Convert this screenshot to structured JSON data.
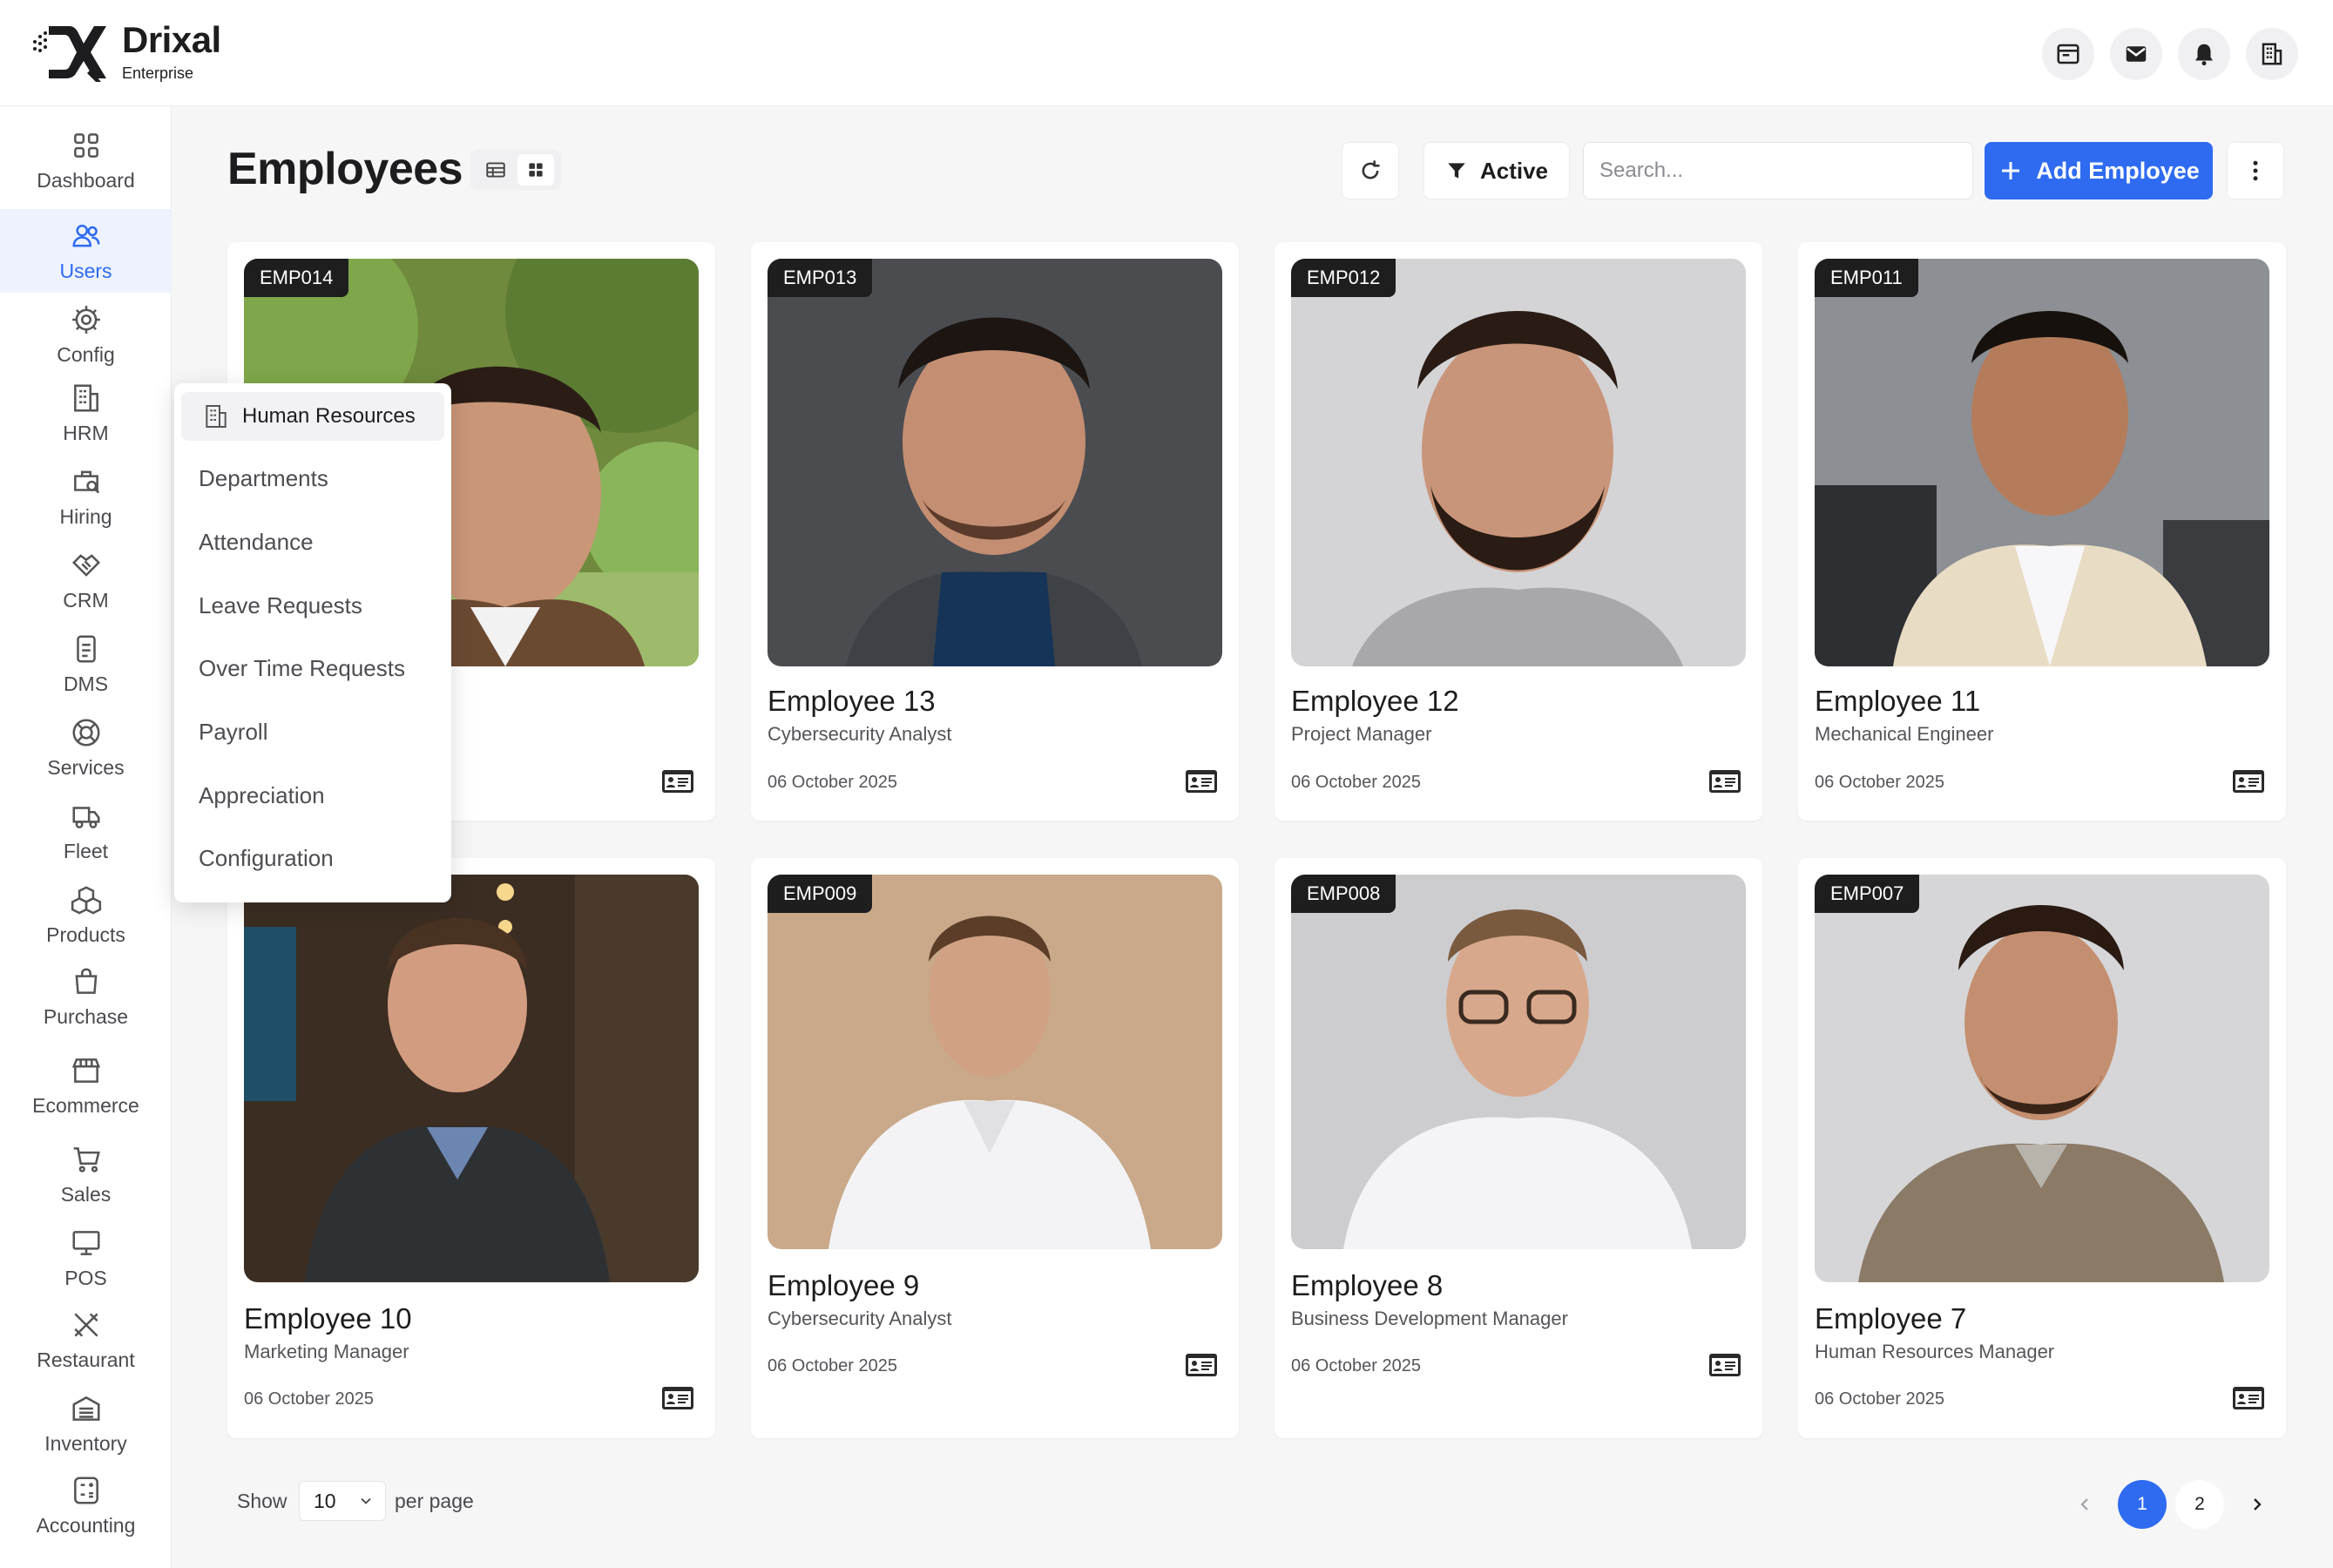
{
  "brand": {
    "name": "Drixal",
    "tagline": "Enterprise"
  },
  "topbar": {
    "icons": [
      "browser-window-icon",
      "mail-icon",
      "bell-icon",
      "building-icon"
    ]
  },
  "sidebar": {
    "items": [
      {
        "label": "Dashboard",
        "icon": "grid-icon"
      },
      {
        "label": "Users",
        "icon": "users-icon",
        "active": true
      },
      {
        "label": "Config",
        "icon": "gear-icon"
      },
      {
        "label": "HRM",
        "icon": "building-icon"
      },
      {
        "label": "Hiring",
        "icon": "briefcase-search-icon"
      },
      {
        "label": "CRM",
        "icon": "handshake-icon"
      },
      {
        "label": "DMS",
        "icon": "document-icon"
      },
      {
        "label": "Services",
        "icon": "lifebuoy-icon"
      },
      {
        "label": "Fleet",
        "icon": "truck-icon"
      },
      {
        "label": "Products",
        "icon": "boxes-icon"
      },
      {
        "label": "Purchase",
        "icon": "shopping-bag-icon"
      },
      {
        "label": "Ecommerce",
        "icon": "store-icon"
      },
      {
        "label": "Sales",
        "icon": "cart-icon"
      },
      {
        "label": "POS",
        "icon": "monitor-icon"
      },
      {
        "label": "Restaurant",
        "icon": "utensils-icon"
      },
      {
        "label": "Inventory",
        "icon": "warehouse-icon"
      },
      {
        "label": "Accounting",
        "icon": "calculator-icon"
      }
    ]
  },
  "hr_menu": {
    "title": "Human Resources",
    "items": [
      "Departments",
      "Attendance",
      "Leave Requests",
      "Over Time Requests",
      "Payroll",
      "Appreciation",
      "Configuration"
    ]
  },
  "page": {
    "title": "Employees",
    "filter_label": "Active",
    "search_placeholder": "Search...",
    "add_label": "Add Employee"
  },
  "employees": [
    {
      "code": "EMP014",
      "name": "",
      "role": "",
      "date": ""
    },
    {
      "code": "EMP013",
      "name": "Employee 13",
      "role": "Cybersecurity Analyst",
      "date": "06 October 2025"
    },
    {
      "code": "EMP012",
      "name": "Employee 12",
      "role": "Project Manager",
      "date": "06 October 2025"
    },
    {
      "code": "EMP011",
      "name": "Employee 11",
      "role": "Mechanical Engineer",
      "date": "06 October 2025"
    },
    {
      "code": "",
      "name": "Employee 10",
      "role": "Marketing Manager",
      "date": "06 October 2025"
    },
    {
      "code": "EMP009",
      "name": "Employee 9",
      "role": "Cybersecurity Analyst",
      "date": "06 October 2025"
    },
    {
      "code": "EMP008",
      "name": "Employee 8",
      "role": "Business Development Manager",
      "date": "06 October 2025"
    },
    {
      "code": "EMP007",
      "name": "Employee 7",
      "role": "Human Resources Manager",
      "date": "06 October 2025"
    }
  ],
  "pagination": {
    "show_label": "Show",
    "per_page_value": "10",
    "per_page_label": "per page",
    "pages": [
      "1",
      "2"
    ],
    "current": "1"
  },
  "colors": {
    "accent": "#2e6bf0",
    "badge": "#1e1e1e",
    "background": "#f6f6f7"
  }
}
